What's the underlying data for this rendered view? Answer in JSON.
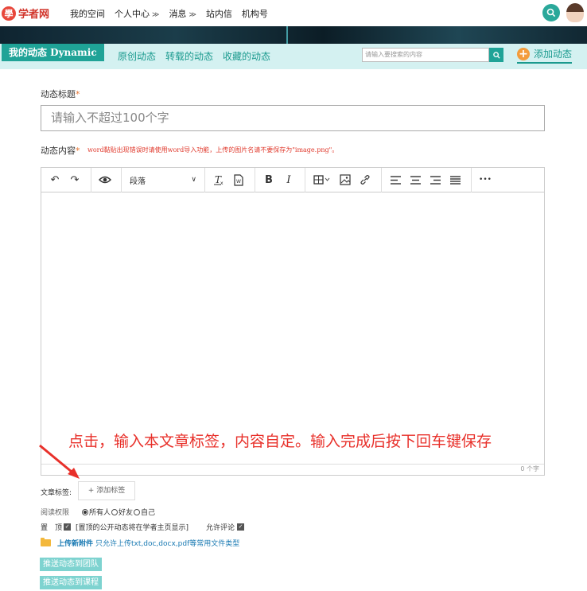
{
  "nav": {
    "logo_mark": "學",
    "logo_text": "学者网",
    "links": [
      {
        "label": "我的空间",
        "has_menu": false
      },
      {
        "label": "个人中心",
        "has_menu": true
      },
      {
        "label": "消息",
        "has_menu": true
      },
      {
        "label": "站内信",
        "has_menu": false
      },
      {
        "label": "机构号",
        "has_menu": false
      }
    ],
    "menu_chevron": "≫"
  },
  "subnav": {
    "title": "我的动态 Dynamic",
    "tabs": [
      "原创动态",
      "转载的动态",
      "收藏的动态"
    ],
    "search_placeholder": "请输入要搜索的内容",
    "add_label": "添加动态",
    "add_icon": "+"
  },
  "form": {
    "title_label": "动态标题",
    "title_placeholder": "请输入不超过100个字",
    "content_label": "动态内容",
    "required_mark": "*",
    "content_hint": "word黏贴出现错误时请使用word导入功能，上传的图片名请不要保存为\"image.png\"。"
  },
  "toolbar": {
    "paragraph_value": "段落",
    "undo_icon": "↶",
    "redo_icon": "↷",
    "bold": "B",
    "italic": "I",
    "more": "•••",
    "counter": "0 个字"
  },
  "annotation": "点击，输入本文章标签，内容自定。输入完成后按下回车键保存",
  "tags": {
    "label": "文章标签:",
    "add_button": "+ 添加标签"
  },
  "permissions": {
    "label": "阅读权限",
    "options": [
      "所有人",
      "好友",
      "自己"
    ],
    "selected": 0
  },
  "pin": {
    "label": "置　顶",
    "check": "✓",
    "note": "[置顶的公开动态将在学者主页显示]",
    "allow_comment": "允许评论"
  },
  "upload": {
    "link": "上传新附件",
    "note": "只允许上传txt,doc,docx,pdf等常用文件类型"
  },
  "buttons": {
    "push_team": "推送动态到团队",
    "push_course": "推送动态到课程"
  },
  "colors": {
    "accent": "#1fa397",
    "annotation_red": "#e8302a",
    "hint_red": "#e03a2d",
    "orange": "#f39c3c"
  }
}
